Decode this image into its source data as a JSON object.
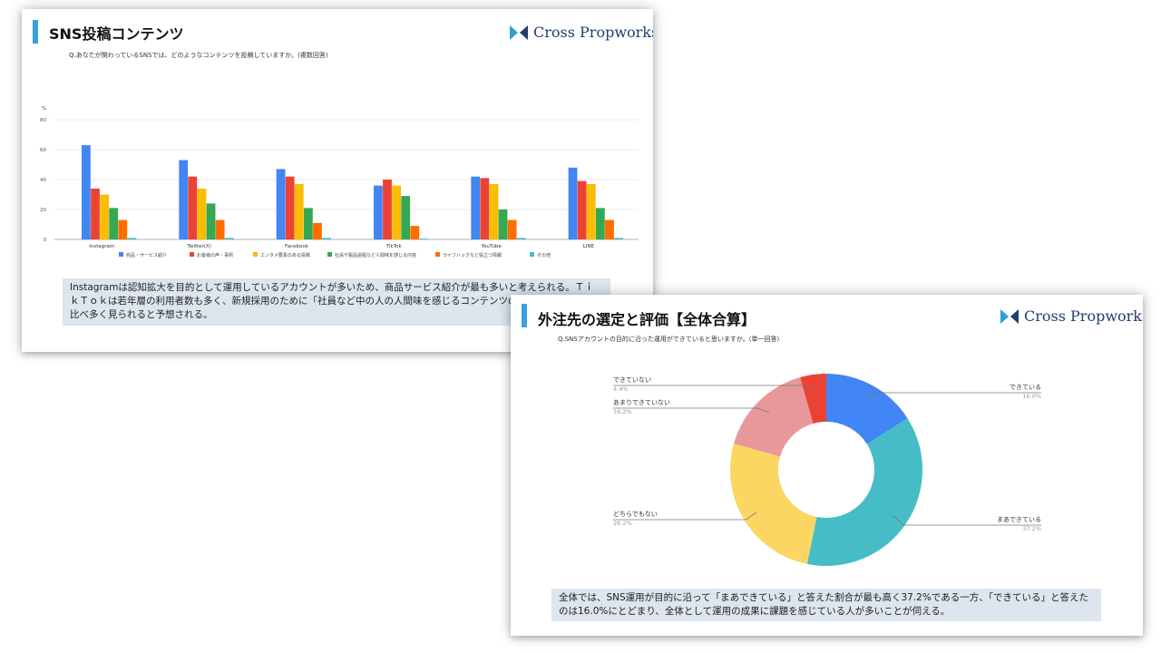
{
  "slide1": {
    "title": "SNS投稿コンテンツ",
    "brand": "Cross Propworks",
    "question": "Q.あなたが関わっているSNSでは、どのようなコンテンツを投稿していますか。(複数回答)",
    "note": "Instagramは認知拡大を目的として運用しているアカウントが多いため、商品サービス紹介が最も多いと考えられる。ＴｉｋＴｏｋは若年層の利用者数も多く、新規採用のために「社員など中の人の人間味を感じるコンテンツの投稿」が、他SNSと比べ多く見られると予想される。"
  },
  "slide2": {
    "title": "外注先の選定と評価【全体合算】",
    "brand": "Cross Propworks",
    "question": "Q.SNSアカウントの目的に沿った運用ができていると思いますか。(単一回答)",
    "note": "全体では、SNS運用が目的に沿って「まあできている」と答えた割合が最も高く37.2%である一方、「できている」と答えたのは16.0%にとどまり、全体として運用の成果に課題を感じている人が多いことが伺える。"
  },
  "chart_data": [
    {
      "type": "bar",
      "ylabel": "%",
      "ylim": [
        0,
        80
      ],
      "yticks": [
        0,
        20,
        40,
        60,
        80
      ],
      "grid": true,
      "legend_position": "bottom",
      "categories": [
        "Instagram",
        "Twitter(X)",
        "Facebook",
        "TikTok",
        "YouTube",
        "LINE"
      ],
      "series": [
        {
          "name": "商品・サービス紹介",
          "color": "#4285f4",
          "values": [
            63,
            53,
            47,
            36,
            42,
            48
          ]
        },
        {
          "name": "お客様の声・事例",
          "color": "#ea4335",
          "values": [
            34,
            42,
            42,
            40,
            41,
            39
          ]
        },
        {
          "name": "エンタメ要素のある投稿",
          "color": "#fbbc04",
          "values": [
            30,
            34,
            37,
            36,
            37,
            37
          ]
        },
        {
          "name": "社員や製品過程など人間味を感じる内容",
          "color": "#34a853",
          "values": [
            21,
            24,
            21,
            29,
            20,
            21
          ]
        },
        {
          "name": "ライフハックなど役立つ情報",
          "color": "#ff6d01",
          "values": [
            13,
            13,
            11,
            9,
            13,
            13
          ]
        },
        {
          "name": "その他",
          "color": "#46bdc6",
          "values": [
            1,
            1,
            1,
            0.5,
            1,
            1
          ]
        }
      ]
    },
    {
      "type": "pie",
      "donut": true,
      "slices": [
        {
          "label": "できている",
          "value": 16.0,
          "display": "16.0%",
          "color": "#4285f4"
        },
        {
          "label": "まあできている",
          "value": 37.2,
          "display": "37.2%",
          "color": "#46bdc6"
        },
        {
          "label": "どちらでもない",
          "value": 26.2,
          "display": "26.2%",
          "color": "#fcd663"
        },
        {
          "label": "あまりできていない",
          "value": 16.2,
          "display": "16.2%",
          "color": "#e8989a"
        },
        {
          "label": "できていない",
          "value": 4.4,
          "display": "4.4%",
          "color": "#ea4335"
        }
      ]
    }
  ]
}
